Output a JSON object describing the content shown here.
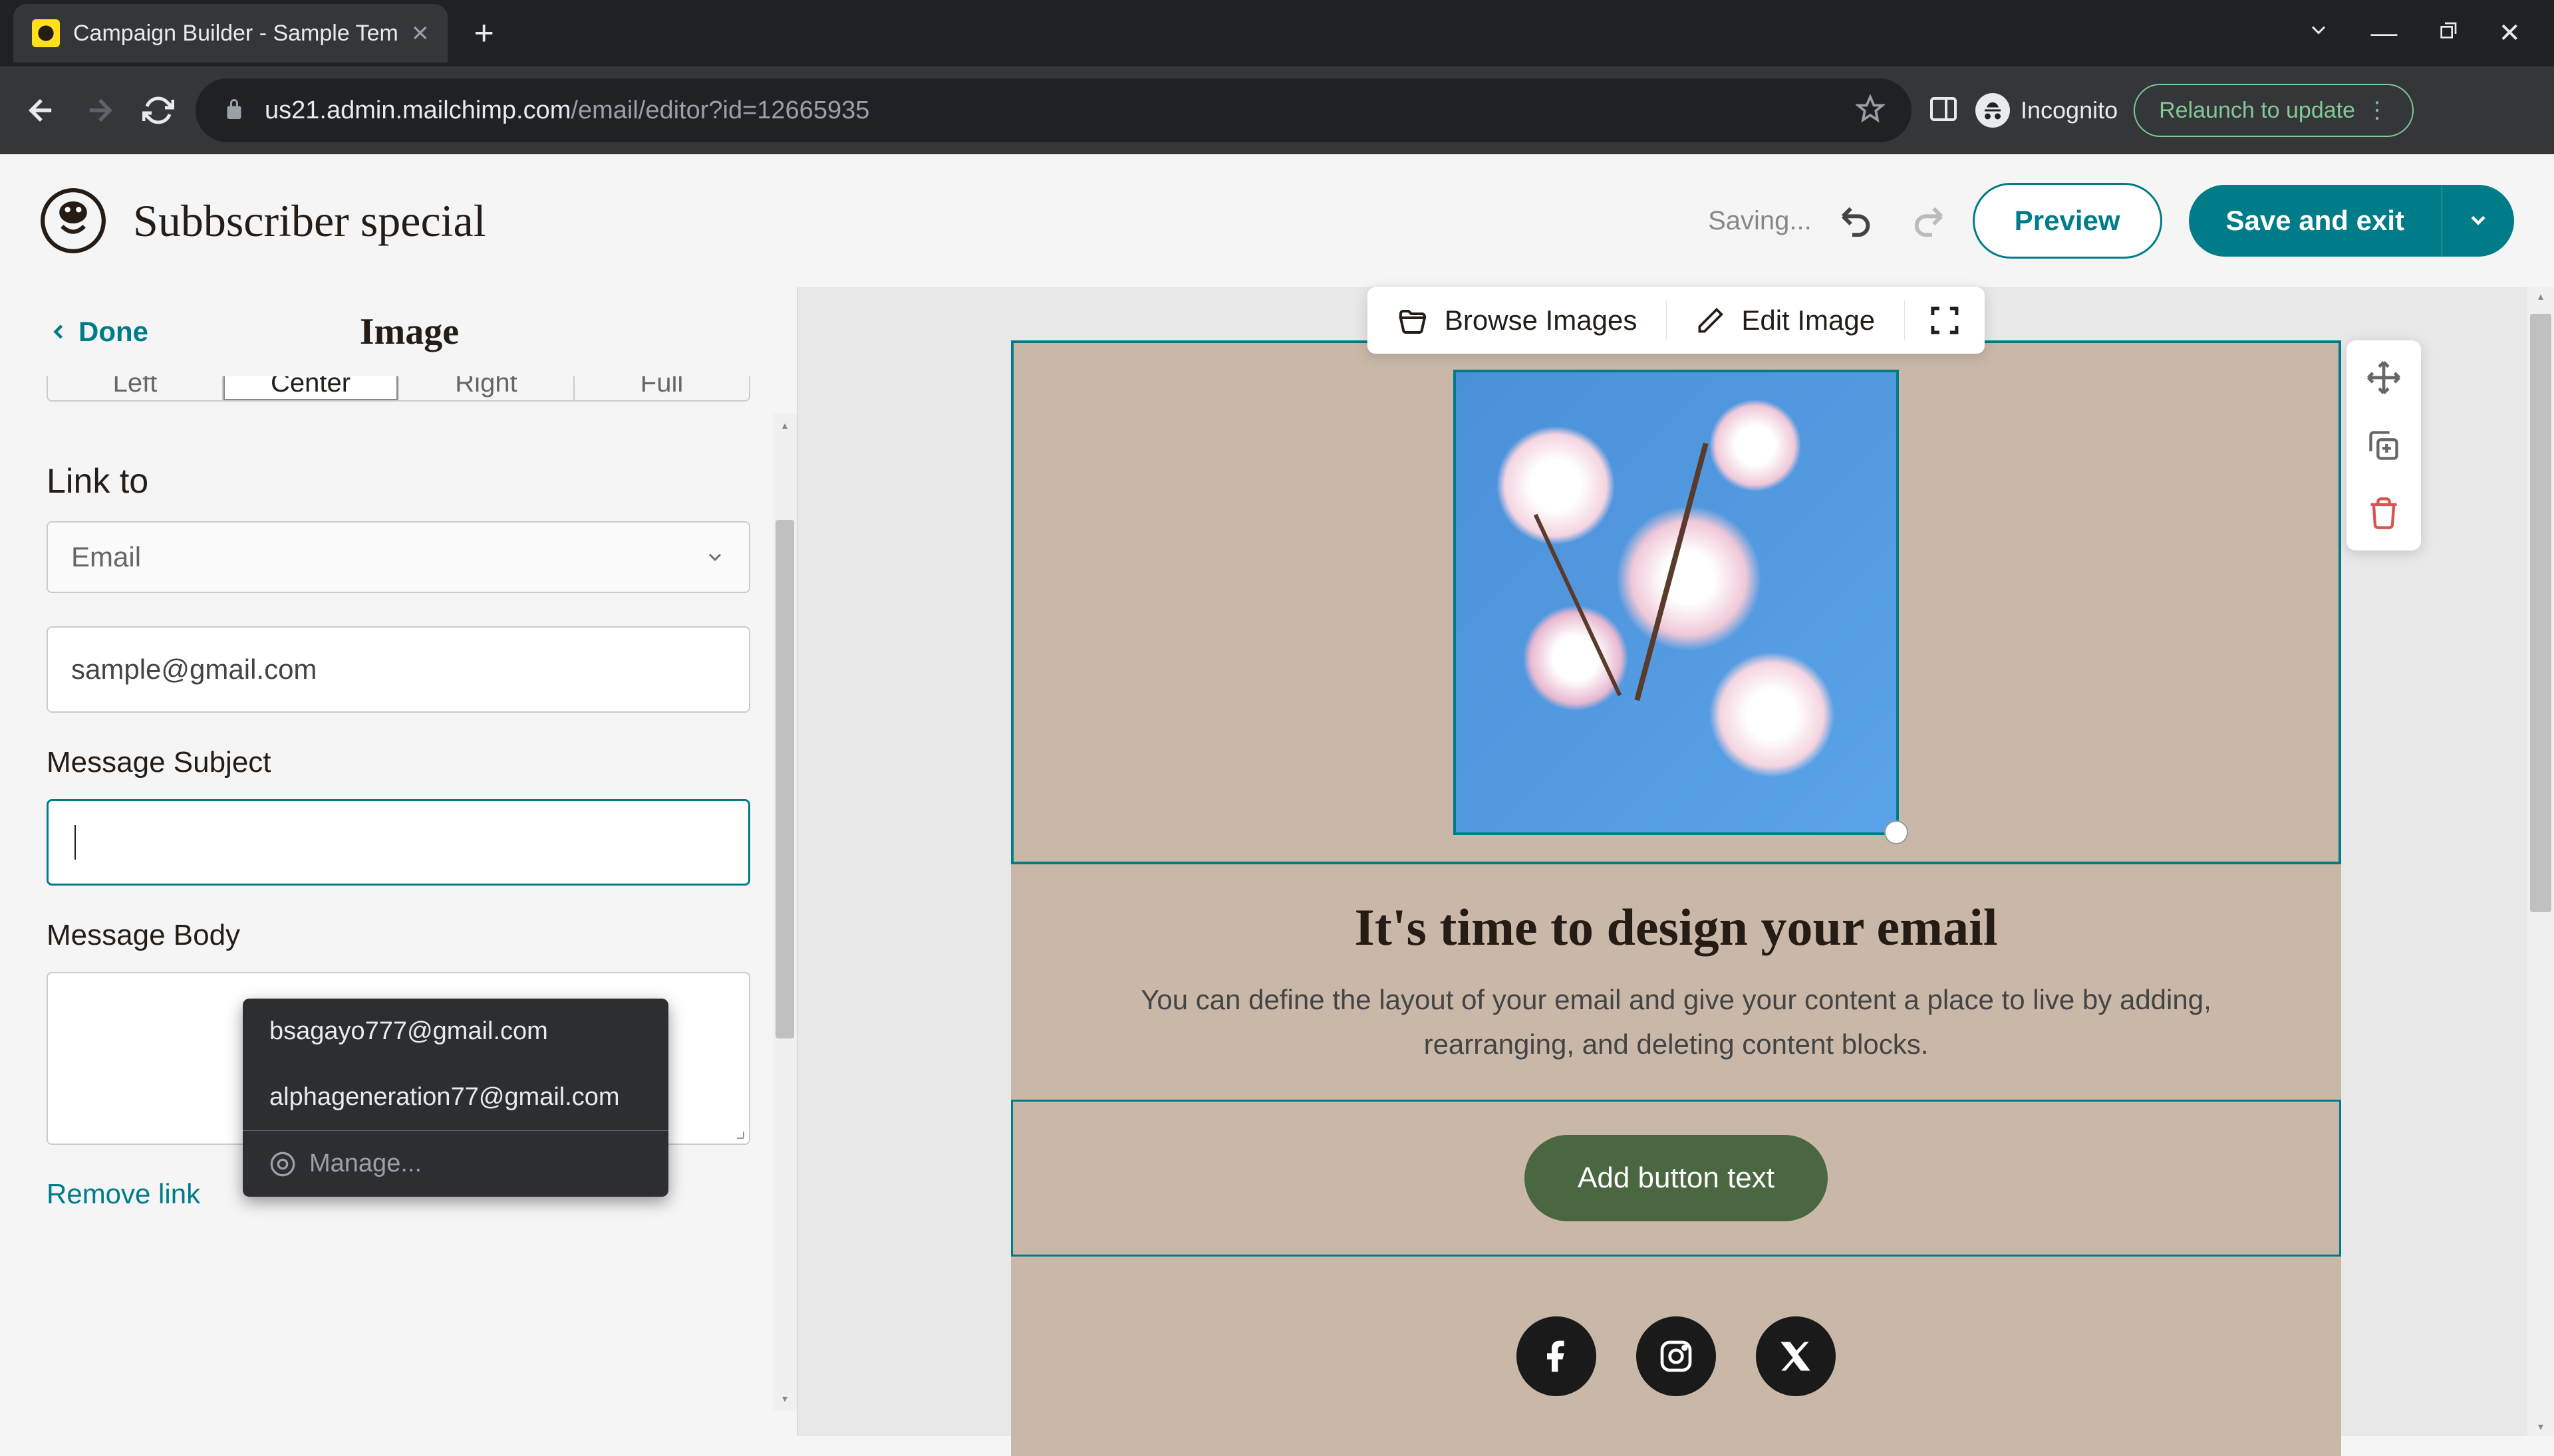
{
  "browser": {
    "tab_title": "Campaign Builder - Sample Tem",
    "url_host": "us21.admin.mailchimp.com",
    "url_path": "/email/editor?id=12665935",
    "incognito_label": "Incognito",
    "relaunch_label": "Relaunch to update"
  },
  "header": {
    "campaign_name": "Subbscriber special",
    "saving_text": "Saving...",
    "preview_label": "Preview",
    "save_exit_label": "Save and exit"
  },
  "sidebar": {
    "done_label": "Done",
    "panel_title": "Image",
    "align": {
      "left": "Left",
      "center": "Center",
      "right": "Right",
      "full": "Full"
    },
    "link_to_label": "Link to",
    "link_type_value": "Email",
    "email_value": "sample@gmail.com",
    "subject_label": "Message Subject",
    "subject_value": "",
    "body_label": "Message Body",
    "body_value": "",
    "remove_link_label": "Remove link"
  },
  "autofill": {
    "item1": "bsagayo777@gmail.com",
    "item2": "alphageneration77@gmail.com",
    "manage_label": "Manage..."
  },
  "context_toolbar": {
    "browse_label": "Browse Images",
    "edit_label": "Edit Image"
  },
  "email_content": {
    "heading": "It's time to design your email",
    "paragraph": "You can define the layout of your email and give your content a place to live by adding, rearranging, and deleting content blocks.",
    "button_label": "Add button text"
  },
  "icons": {
    "folder": "folder-open-icon",
    "pencil": "pencil-icon",
    "fullscreen": "fullscreen-icon",
    "move": "move-icon",
    "duplicate": "duplicate-icon",
    "delete": "trash-icon"
  },
  "colors": {
    "primary": "#007c89",
    "text_dark": "#241c15",
    "canvas_bg": "#c9b8a8",
    "button_green": "#4a6741"
  }
}
